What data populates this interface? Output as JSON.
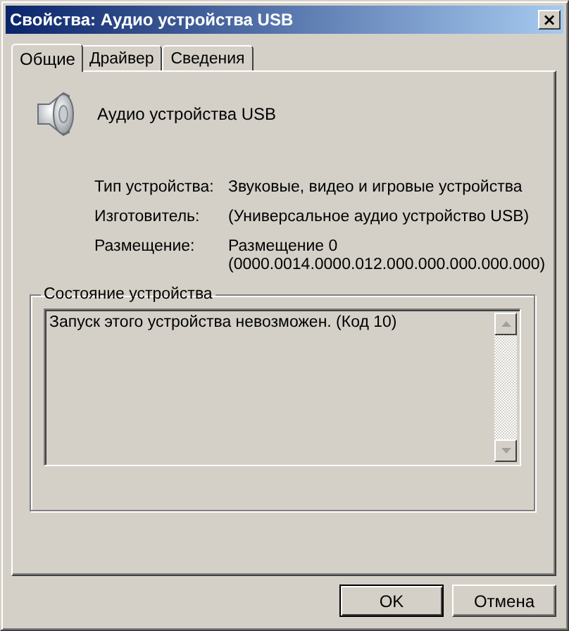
{
  "window": {
    "title": "Свойства: Аудио устройства USB",
    "close": "×"
  },
  "tabs": [
    {
      "label": "Общие",
      "selected": true
    },
    {
      "label": "Драйвер",
      "selected": false
    },
    {
      "label": "Сведения",
      "selected": false
    }
  ],
  "device": {
    "name": "Аудио устройства USB"
  },
  "properties": [
    {
      "label": "Тип устройства:",
      "lines": [
        "Звуковые, видео и игровые устройства"
      ]
    },
    {
      "label": "Изготовитель:",
      "lines": [
        "(Универсальное аудио устройство USB)"
      ]
    },
    {
      "label": "Размещение:",
      "lines": [
        "Размещение 0",
        "(0000.0014.0000.012.000.000.000.000.000)"
      ]
    }
  ],
  "status": {
    "title": "Состояние устройства",
    "text": "Запуск этого устройства невозможен. (Код 10)"
  },
  "buttons": [
    {
      "label": "OK",
      "kind": "default"
    },
    {
      "label": "Отмена",
      "kind": "normal"
    }
  ]
}
